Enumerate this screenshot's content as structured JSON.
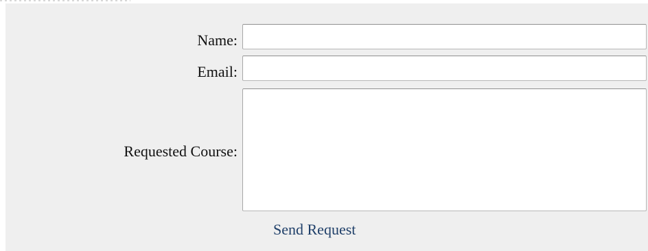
{
  "form": {
    "name": {
      "label": "Name:",
      "value": ""
    },
    "email": {
      "label": "Email:",
      "value": ""
    },
    "requested_course": {
      "label": "Requested Course:",
      "value": ""
    },
    "submit_label": "Send Request"
  },
  "colors": {
    "page_background": "#efefef",
    "field_background": "#ffffff",
    "label_text": "#111111",
    "link_text": "#1f3f69"
  }
}
